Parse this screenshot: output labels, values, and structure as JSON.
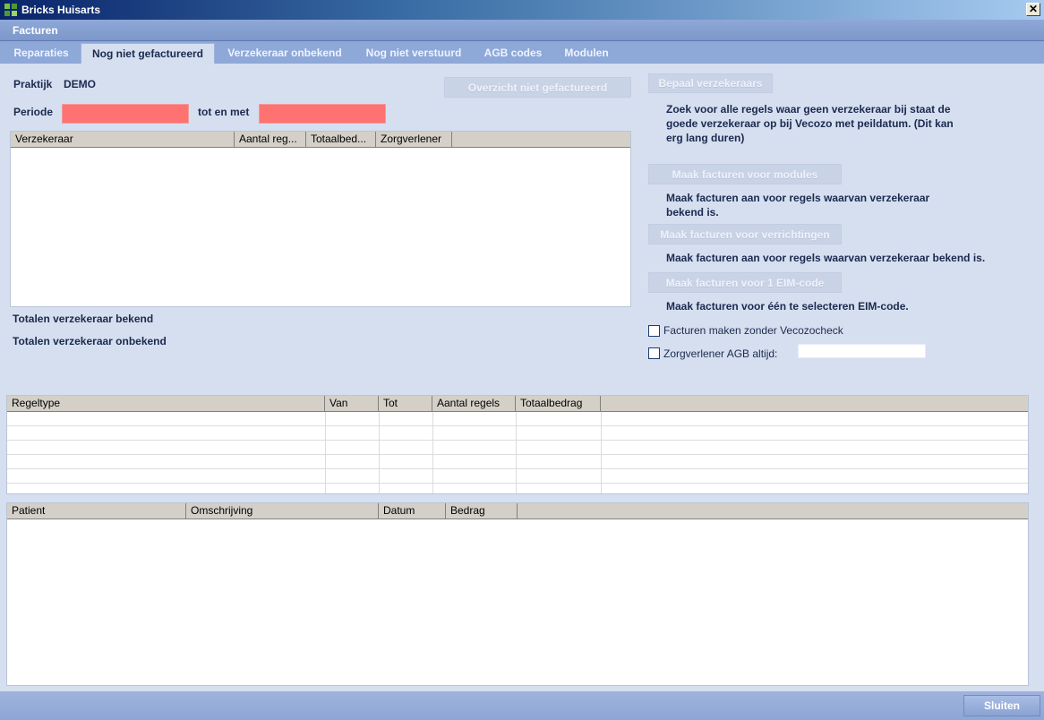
{
  "window": {
    "title": "Bricks Huisarts",
    "close_glyph": "✕"
  },
  "section": {
    "title": "Facturen"
  },
  "tabs": [
    {
      "label": "Reparaties"
    },
    {
      "label": "Nog niet gefactureerd"
    },
    {
      "label": "Verzekeraar onbekend"
    },
    {
      "label": "Nog niet verstuurd"
    },
    {
      "label": "AGB codes"
    },
    {
      "label": "Modulen"
    }
  ],
  "form": {
    "praktijk_label": "Praktijk",
    "praktijk_value": "DEMO",
    "periode_label": "Periode",
    "tot_en_met_label": "tot en met",
    "periode_van": "",
    "periode_tot": ""
  },
  "buttons": {
    "overzicht": "Overzicht niet gefactureerd",
    "bepaal": "Bepaal verzekeraars",
    "modules": "Maak facturen voor modules",
    "verrichtingen": "Maak facturen voor verrichtingen",
    "eim": "Maak facturen voor 1 EIM-code",
    "sluiten": "Sluiten"
  },
  "descriptions": {
    "bepaal": "Zoek voor alle regels waar geen verzekeraar bij staat de goede verzekeraar op bij Vecozo met peildatum. (Dit kan erg lang duren)",
    "modules": "Maak facturen aan voor regels waarvan verzekeraar bekend is.",
    "verrichtingen": "Maak facturen aan voor regels waarvan verzekeraar bekend is.",
    "eim": "Maak facturen voor één te selecteren EIM-code."
  },
  "checkboxes": {
    "zonder_vecozo": {
      "label": "Facturen maken  zonder Vecozocheck",
      "checked": false
    },
    "agb_altijd": {
      "label": "Zorgverlener AGB altijd:",
      "checked": false,
      "value": ""
    }
  },
  "totals": {
    "bekend": "Totalen verzekeraar bekend",
    "onbekend": "Totalen verzekeraar onbekend"
  },
  "table_verzekeraar": {
    "columns": [
      "Verzekeraar",
      "Aantal reg...",
      "Totaalbed...",
      "Zorgverlener"
    ],
    "rows": []
  },
  "table_regeltype": {
    "columns": [
      "Regeltype",
      "Van",
      "Tot",
      "Aantal regels",
      "Totaalbedrag"
    ],
    "rows": [
      [
        "",
        "",
        "",
        "",
        ""
      ],
      [
        "",
        "",
        "",
        "",
        ""
      ],
      [
        "",
        "",
        "",
        "",
        ""
      ],
      [
        "",
        "",
        "",
        "",
        ""
      ],
      [
        "",
        "",
        "",
        "",
        ""
      ],
      [
        "",
        "",
        "",
        "",
        ""
      ]
    ]
  },
  "table_patient": {
    "columns": [
      "Patient",
      "Omschrijving",
      "Datum",
      "Bedrag"
    ],
    "rows": []
  }
}
